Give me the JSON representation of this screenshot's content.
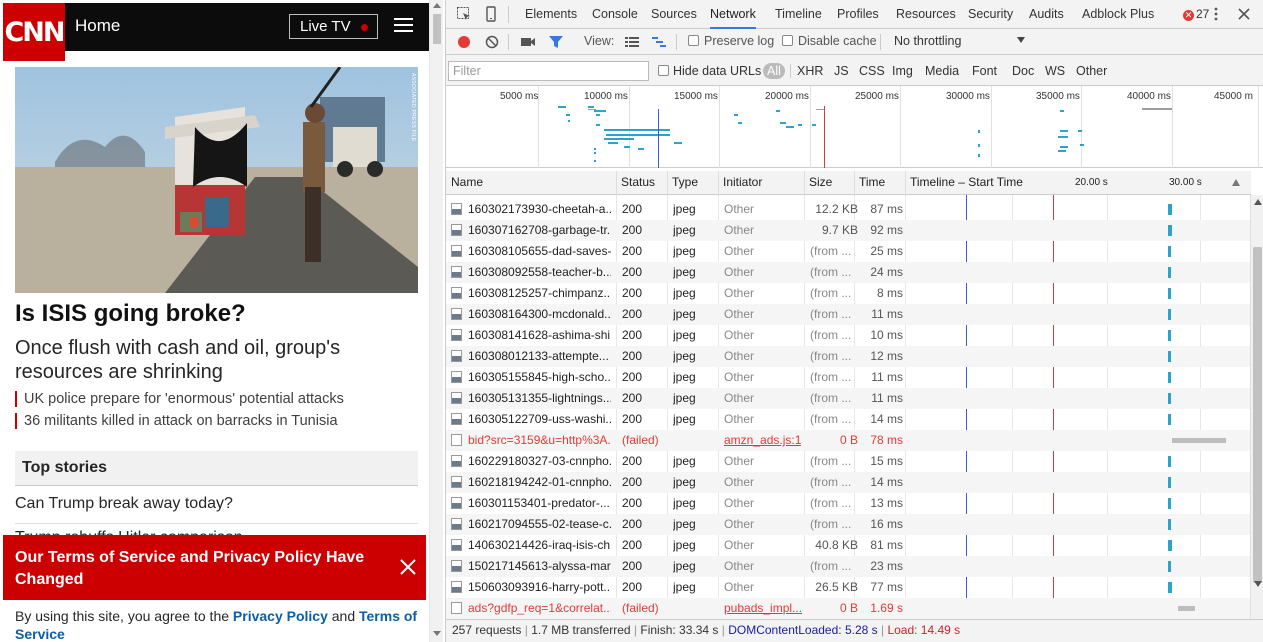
{
  "cnn": {
    "logo": "CNN",
    "home": "Home",
    "live_tv": "Live TV",
    "hero_credit": "ASSOCIATED PRESS FILE",
    "headline": "Is ISIS going broke?",
    "subhead": "Once flush with cash and oil, group's resources are shrinking",
    "bullets": [
      "UK police prepare for 'enormous' potential attacks",
      "36 militants killed in attack on barracks in Tunisia"
    ],
    "top_stories": "Top stories",
    "stories": [
      "Can Trump break away today?",
      "Trump rebuffs Hitler comparison"
    ],
    "tos_title": "Our Terms of Service and Privacy Policy Have Changed",
    "tos_body_1": "By using this site, you agree to the ",
    "tos_privacy": "Privacy Policy",
    "tos_and": " and ",
    "tos_terms": "Terms of Service",
    "brand_red": "#cc0000"
  },
  "devtools": {
    "tabs": [
      "Elements",
      "Console",
      "Sources",
      "Network",
      "Timeline",
      "Profiles",
      "Resources",
      "Security",
      "Audits",
      "Adblock Plus"
    ],
    "active_tab": "Network",
    "error_count": "27",
    "toolbar": {
      "view": "View:",
      "preserve_log": "Preserve log",
      "disable_cache": "Disable cache",
      "throttling": "No throttling"
    },
    "filter": {
      "placeholder": "Filter",
      "hide_data_urls": "Hide data URLs",
      "types": [
        "All",
        "XHR",
        "JS",
        "CSS",
        "Img",
        "Media",
        "Font",
        "Doc",
        "WS",
        "Other"
      ]
    },
    "overview_ticks": [
      "5000 ms",
      "10000 ms",
      "15000 ms",
      "20000 ms",
      "25000 ms",
      "30000 ms",
      "35000 ms",
      "40000 ms",
      "45000 m"
    ],
    "columns": [
      "Name",
      "Status",
      "Type",
      "Initiator",
      "Size",
      "Time",
      "Timeline – Start Time",
      "20.00 s",
      "30.00 s"
    ],
    "rows": [
      {
        "name": "160302173930-cheetah-a...",
        "status": "200",
        "type": "jpeg",
        "initiator": "Other",
        "size": "12.2 KB",
        "time": "87 ms",
        "from": false,
        "failed": false,
        "start": 0.94,
        "dur": 0.012
      },
      {
        "name": "160307162708-garbage-tr...",
        "status": "200",
        "type": "jpeg",
        "initiator": "Other",
        "size": "9.7 KB",
        "time": "92 ms",
        "from": false,
        "failed": false,
        "start": 0.94,
        "dur": 0.012
      },
      {
        "name": "160308105655-dad-saves-...",
        "status": "200",
        "type": "jpeg",
        "initiator": "Other",
        "size": "(from ...",
        "time": "25 ms",
        "from": true,
        "failed": false,
        "start": 0.94,
        "dur": 0.008
      },
      {
        "name": "160308092558-teacher-b...",
        "status": "200",
        "type": "jpeg",
        "initiator": "Other",
        "size": "(from ...",
        "time": "24 ms",
        "from": true,
        "failed": false,
        "start": 0.94,
        "dur": 0.008
      },
      {
        "name": "160308125257-chimpanz...",
        "status": "200",
        "type": "jpeg",
        "initiator": "Other",
        "size": "(from ...",
        "time": "8 ms",
        "from": true,
        "failed": false,
        "start": 0.94,
        "dur": 0.008
      },
      {
        "name": "160308164300-mcdonald...",
        "status": "200",
        "type": "jpeg",
        "initiator": "Other",
        "size": "(from ...",
        "time": "11 ms",
        "from": true,
        "failed": false,
        "start": 0.94,
        "dur": 0.008
      },
      {
        "name": "160308141628-ashima-shi...",
        "status": "200",
        "type": "jpeg",
        "initiator": "Other",
        "size": "(from ...",
        "time": "10 ms",
        "from": true,
        "failed": false,
        "start": 0.94,
        "dur": 0.008
      },
      {
        "name": "160308012133-attempte...",
        "status": "200",
        "type": "jpeg",
        "initiator": "Other",
        "size": "(from ...",
        "time": "12 ms",
        "from": true,
        "failed": false,
        "start": 0.94,
        "dur": 0.008
      },
      {
        "name": "160305155845-high-scho...",
        "status": "200",
        "type": "jpeg",
        "initiator": "Other",
        "size": "(from ...",
        "time": "11 ms",
        "from": true,
        "failed": false,
        "start": 0.94,
        "dur": 0.008
      },
      {
        "name": "160305131355-lightnings...",
        "status": "200",
        "type": "jpeg",
        "initiator": "Other",
        "size": "(from ...",
        "time": "11 ms",
        "from": true,
        "failed": false,
        "start": 0.94,
        "dur": 0.008
      },
      {
        "name": "160305122709-uss-washi...",
        "status": "200",
        "type": "jpeg",
        "initiator": "Other",
        "size": "(from ...",
        "time": "14 ms",
        "from": true,
        "failed": false,
        "start": 0.94,
        "dur": 0.008
      },
      {
        "name": "bid?src=3159&u=http%3A...",
        "status": "(failed)",
        "type": "",
        "initiator": "amzn_ads.js:1",
        "size": "0 B",
        "time": "78 ms",
        "from": false,
        "failed": true,
        "start": 0.94,
        "dur": 0.16
      },
      {
        "name": "160229180327-03-cnnpho...",
        "status": "200",
        "type": "jpeg",
        "initiator": "Other",
        "size": "(from ...",
        "time": "15 ms",
        "from": true,
        "failed": false,
        "start": 0.94,
        "dur": 0.008
      },
      {
        "name": "160218194242-01-cnnpho...",
        "status": "200",
        "type": "jpeg",
        "initiator": "Other",
        "size": "(from ...",
        "time": "14 ms",
        "from": true,
        "failed": false,
        "start": 0.94,
        "dur": 0.008
      },
      {
        "name": "160301153401-predator-...",
        "status": "200",
        "type": "jpeg",
        "initiator": "Other",
        "size": "(from ...",
        "time": "13 ms",
        "from": true,
        "failed": false,
        "start": 0.94,
        "dur": 0.008
      },
      {
        "name": "160217094555-02-tease-c...",
        "status": "200",
        "type": "jpeg",
        "initiator": "Other",
        "size": "(from ...",
        "time": "16 ms",
        "from": true,
        "failed": false,
        "start": 0.94,
        "dur": 0.008
      },
      {
        "name": "140630214426-iraq-isis-ch...",
        "status": "200",
        "type": "jpeg",
        "initiator": "Other",
        "size": "40.8 KB",
        "time": "81 ms",
        "from": false,
        "failed": false,
        "start": 0.94,
        "dur": 0.012
      },
      {
        "name": "150217145613-alyssa-mar...",
        "status": "200",
        "type": "jpeg",
        "initiator": "Other",
        "size": "(from ...",
        "time": "23 ms",
        "from": true,
        "failed": false,
        "start": 0.94,
        "dur": 0.008
      },
      {
        "name": "150603093916-harry-pott...",
        "status": "200",
        "type": "jpeg",
        "initiator": "Other",
        "size": "26.5 KB",
        "time": "77 ms",
        "from": false,
        "failed": false,
        "start": 0.94,
        "dur": 0.012
      },
      {
        "name": "ads?gdfp_req=1&correlat...",
        "status": "(failed)",
        "type": "",
        "initiator": "pubads_impl...",
        "size": "0 B",
        "time": "1.69 s",
        "from": false,
        "failed": true,
        "start": 0.96,
        "dur": 0.05
      }
    ],
    "status_bar": {
      "requests": "257 requests",
      "transferred": "1.7 MB transferred",
      "finish": "Finish: 33.34 s",
      "dcl": "DOMContentLoaded: 5.28 s",
      "load": "Load: 14.49 s"
    },
    "colors": {
      "accent": "#3879d9",
      "bar": "#2aa4cc",
      "dcl": "#3b5bd6",
      "load": "#d23c3c"
    }
  }
}
